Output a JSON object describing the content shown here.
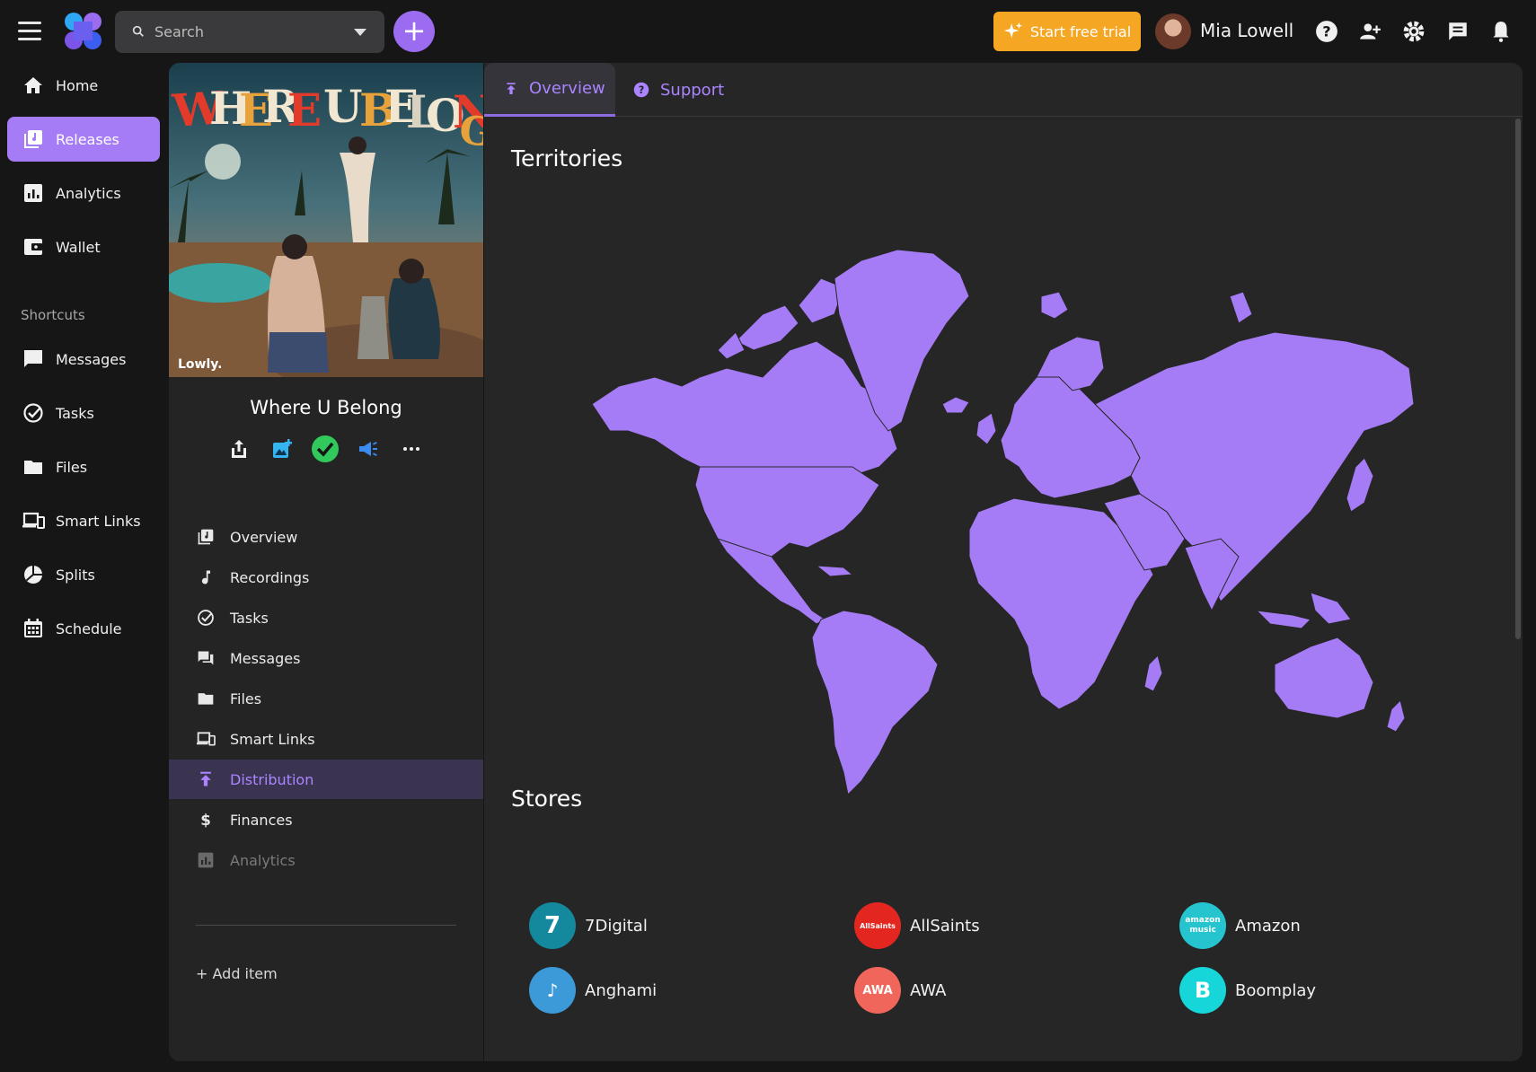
{
  "topbar": {
    "search_placeholder": "Search",
    "trial_label": "Start free trial",
    "user_name": "Mia Lowell"
  },
  "nav": {
    "items": [
      {
        "label": "Home",
        "icon": "home-icon"
      },
      {
        "label": "Releases",
        "icon": "releases-icon",
        "active": true
      },
      {
        "label": "Analytics",
        "icon": "analytics-icon"
      },
      {
        "label": "Wallet",
        "icon": "wallet-icon"
      }
    ],
    "shortcuts_heading": "Shortcuts",
    "shortcuts": [
      {
        "label": "Messages",
        "icon": "message-icon"
      },
      {
        "label": "Tasks",
        "icon": "tasks-icon"
      },
      {
        "label": "Files",
        "icon": "folder-icon"
      },
      {
        "label": "Smart Links",
        "icon": "devices-icon"
      },
      {
        "label": "Splits",
        "icon": "pie-icon"
      },
      {
        "label": "Schedule",
        "icon": "calendar-icon"
      }
    ]
  },
  "release": {
    "cover_title": "WHERE U BELONG",
    "cover_label": "Lowly.",
    "title": "Where U Belong",
    "menu": [
      {
        "label": "Overview",
        "icon": "releases-icon"
      },
      {
        "label": "Recordings",
        "icon": "music-note-icon"
      },
      {
        "label": "Tasks",
        "icon": "tasks-icon"
      },
      {
        "label": "Messages",
        "icon": "messages-icon"
      },
      {
        "label": "Files",
        "icon": "folder-icon"
      },
      {
        "label": "Smart Links",
        "icon": "devices-icon"
      },
      {
        "label": "Distribution",
        "icon": "upload-icon",
        "active": true
      },
      {
        "label": "Finances",
        "icon": "dollar-icon"
      },
      {
        "label": "Analytics",
        "icon": "analytics-icon",
        "disabled": true
      }
    ],
    "add_item": "+ Add item"
  },
  "main": {
    "tabs": [
      {
        "label": "Overview",
        "active": true
      },
      {
        "label": "Support"
      }
    ],
    "territories_heading": "Territories",
    "stores_heading": "Stores",
    "stores": [
      {
        "name": "7Digital",
        "color": "#14889c",
        "mark": "7"
      },
      {
        "name": "AllSaints",
        "color": "#e3261f",
        "mark": "AllSaints"
      },
      {
        "name": "Amazon",
        "color": "#25c4cf",
        "mark": "amazon music"
      },
      {
        "name": "Anghami",
        "color": "#3d9ad9",
        "mark": "♪"
      },
      {
        "name": "AWA",
        "color": "#f0665a",
        "mark": "AWA"
      },
      {
        "name": "Boomplay",
        "color": "#16d6d9",
        "mark": "B"
      }
    ]
  },
  "colors": {
    "accent": "#a57cf5",
    "map_fill": "#a57cf5",
    "trial": "#f5a623"
  }
}
